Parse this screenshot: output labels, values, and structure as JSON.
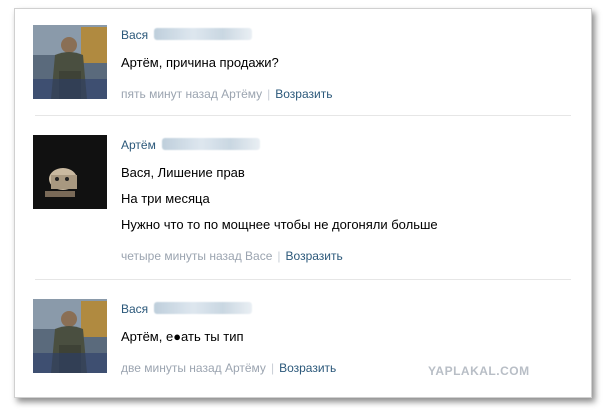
{
  "posts": [
    {
      "author_first": "Вася",
      "lines": [
        "Артём, причина продажи?"
      ],
      "time": "пять минут назад Артёму",
      "separator": "|",
      "reply": "Возразить"
    },
    {
      "author_first": "Артём",
      "lines": [
        "Вася, Лишение прав",
        "На три месяца",
        "Нужно что то по мощнее чтобы не догоняли больше"
      ],
      "time": "четыре минуты назад Васе",
      "separator": "|",
      "reply": "Возразить"
    },
    {
      "author_first": "Вася",
      "lines": [
        "Артём, е●ать ты тип"
      ],
      "time": "две минуты назад Артёму",
      "separator": "|",
      "reply": "Возразить"
    }
  ],
  "watermark": "YAPLAKAL.COM",
  "colors": {
    "link": "#2b587a",
    "meta": "#9ba4b0",
    "divider": "#e6e6e6"
  }
}
